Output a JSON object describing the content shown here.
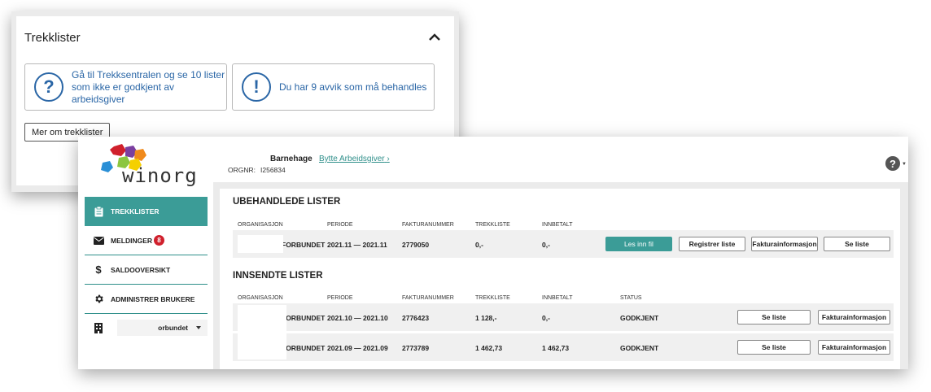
{
  "trekklister_panel": {
    "title": "Trekklister",
    "card1_text": "Gå til Trekksentralen og se 10 lister som ikke er godkjent av arbeidsgiver",
    "card1_icon": "?",
    "card2_text": "Du har 9 avvik som må behandles",
    "card2_icon": "!",
    "more_button": "Mer om trekklister"
  },
  "app": {
    "logo_text": "winorg",
    "nav": [
      {
        "label": "TREKKLISTER",
        "icon": "clipboard-icon",
        "active": true
      },
      {
        "label": "MELDINGER",
        "icon": "envelope-icon",
        "badge": "8"
      },
      {
        "label": "SALDOOVERSIKT",
        "icon": "dollar-icon"
      },
      {
        "label": "ADMINISTRER BRUKERE",
        "icon": "gear-icon"
      }
    ],
    "org_select_value": "orbundet",
    "header": {
      "org_name": "Barnehage",
      "switch_link": "Bytte Arbeidsgiver",
      "switch_arrow": "›",
      "orgnr_label": "ORGNR:",
      "orgnr_value": "I256834"
    },
    "unprocessed": {
      "title": "UBEHANDLEDE LISTER",
      "columns": [
        "ORGANISASJON",
        "PERIODE",
        "FAKTURANUMMER",
        "TREKKLISTE",
        "INNBETALT"
      ],
      "rows": [
        {
          "org": "FORBUNDET",
          "period": "2021.11 — 2021.11",
          "invoice": "2779050",
          "list": "0,-",
          "paid": "0,-"
        }
      ],
      "buttons": {
        "read_file": "Les inn fil",
        "register": "Registrer liste",
        "invoice_info": "Fakturainformasjon",
        "view": "Se liste"
      }
    },
    "submitted": {
      "title": "INNSENDTE LISTER",
      "columns": [
        "ORGANISASJON",
        "PERIODE",
        "FAKTURANUMMER",
        "TREKKLISTE",
        "INNBETALT",
        "STATUS"
      ],
      "rows": [
        {
          "org": "FORBUNDET",
          "period": "2021.10 — 2021.10",
          "invoice": "2776423",
          "list": "1 128,-",
          "paid": "0,-",
          "status": "GODKJENT"
        },
        {
          "org": "FORBUNDET",
          "period": "2021.09 — 2021.09",
          "invoice": "2773789",
          "list": "1 462,73",
          "paid": "1 462,73",
          "status": "GODKJENT"
        }
      ],
      "buttons": {
        "view": "Se liste",
        "invoice_info": "Fakturainformasjon"
      }
    },
    "colors": {
      "accent": "#3b9c97",
      "link": "#2a66a6",
      "badge": "#d0202c"
    }
  }
}
